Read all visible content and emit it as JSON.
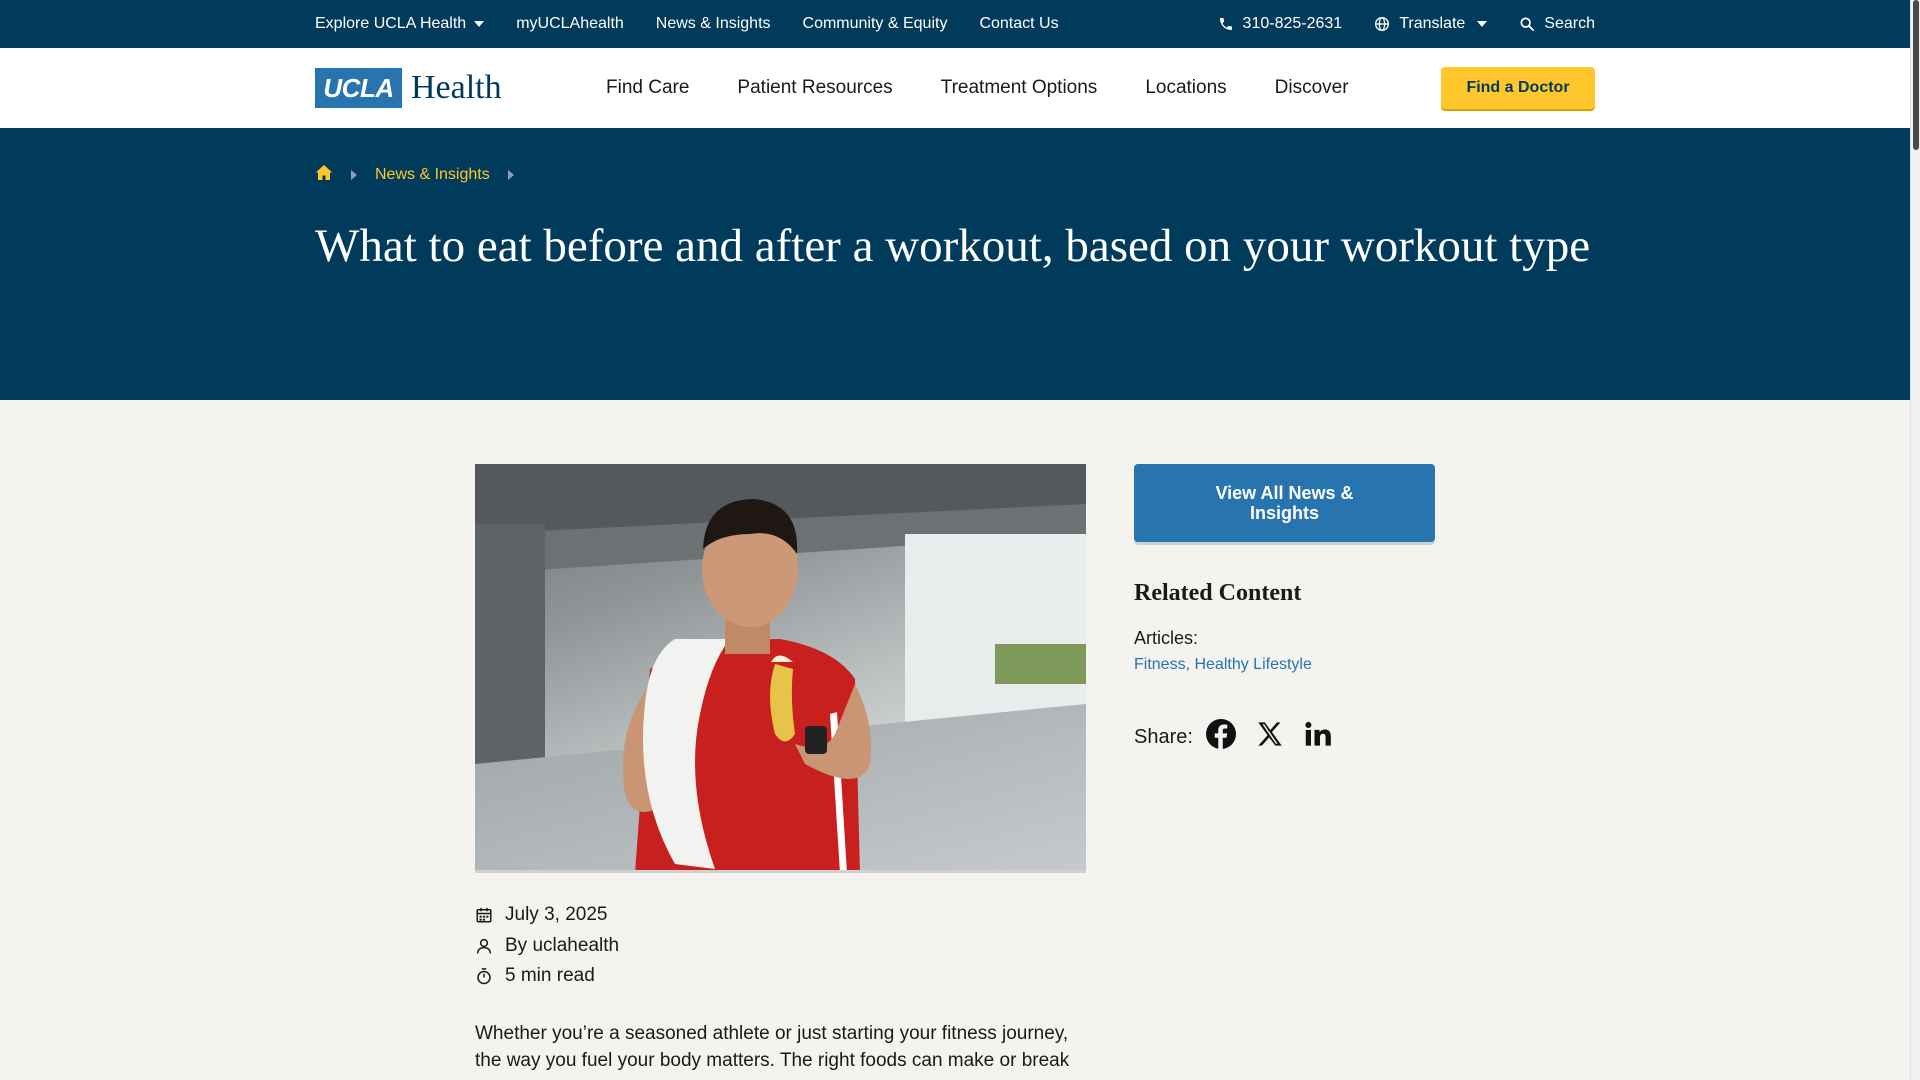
{
  "utility": {
    "explore": "Explore UCLA Health",
    "myucla": "myUCLAhealth",
    "news": "News & Insights",
    "community": "Community & Equity",
    "contact": "Contact Us",
    "phone": "310-825-2631",
    "translate": "Translate",
    "search": "Search"
  },
  "header": {
    "logo_box": "UCLA",
    "logo_word": "Health",
    "nav": [
      "Find Care",
      "Patient Resources",
      "Treatment Options",
      "Locations",
      "Discover"
    ],
    "cta": "Find a Doctor"
  },
  "breadcrumb": {
    "items": [
      "News & Insights"
    ]
  },
  "hero": {
    "title": "What to eat before and after a workout, based on your workout type"
  },
  "meta": {
    "date": "July 3, 2025",
    "author": "By uclahealth",
    "read_time": "5 min read"
  },
  "intro": "Whether you’re a seasoned athlete or just starting your fitness journey, the way you fuel your body matters. The right foods can make or break",
  "sidebar": {
    "view_all": "View All News & Insights",
    "related_heading": "Related Content",
    "articles_label": "Articles:",
    "article_links": [
      {
        "label": "Fitness",
        "sep": ", "
      },
      {
        "label": "Healthy Lifestyle",
        "sep": ""
      }
    ],
    "share_label": "Share:"
  },
  "colors": {
    "navy": "#003b5c",
    "ucla_blue": "#2774ae",
    "gold": "#ffc72c",
    "page_bg": "#f4f3f0"
  },
  "icons": [
    "caret-down-icon",
    "phone-icon",
    "globe-icon",
    "search-icon",
    "home-icon",
    "calendar-icon",
    "person-icon",
    "stopwatch-icon",
    "facebook-icon",
    "x-icon",
    "linkedin-icon"
  ]
}
